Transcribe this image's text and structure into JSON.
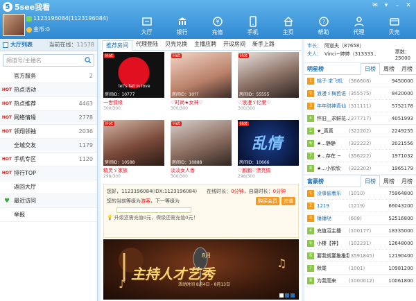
{
  "app": {
    "name": "5see我看",
    "logo_glyph": "5",
    "colors": {
      "brand": "#2f89d2",
      "hot": "#e2231a",
      "rank_top": "#f39a1c",
      "rank": "#8ac74b"
    }
  },
  "user": {
    "account": "1123196084(1123196084)",
    "coins": "金币:0"
  },
  "nav": [
    {
      "label": "大厅",
      "icon": "hall-icon"
    },
    {
      "label": "银行",
      "icon": "bank-icon"
    },
    {
      "label": "充值",
      "icon": "recharge-icon"
    },
    {
      "label": "手机",
      "icon": "phone-icon"
    },
    {
      "label": "主页",
      "icon": "home-icon"
    },
    {
      "label": "帮助",
      "icon": "help-icon"
    },
    {
      "label": "代理",
      "icon": "agent-icon"
    },
    {
      "label": "贝壳",
      "icon": "shell-icon"
    }
  ],
  "left": {
    "tab_label": "大厅列表",
    "online_label": "当前在线：",
    "online_count": "11578",
    "search_placeholder": "频道号/主播名",
    "categories": [
      {
        "badge": "",
        "name": "官方服务",
        "count": "2"
      },
      {
        "badge": "HOT",
        "name": "热点活动",
        "count": ""
      },
      {
        "badge": "HOT",
        "name": "热点推荐",
        "count": "4463"
      },
      {
        "badge": "HOT",
        "name": "网络情缘",
        "count": "2778"
      },
      {
        "badge": "HOT",
        "name": "领翔领袖",
        "count": "2036"
      },
      {
        "badge": "",
        "name": "全城交友",
        "count": "1179"
      },
      {
        "badge": "HOT",
        "name": "手机专区",
        "count": "1120"
      },
      {
        "badge": "HOT",
        "name": "排行TOP",
        "count": ""
      },
      {
        "badge": "",
        "name": "返回大厅",
        "count": ""
      },
      {
        "badge": "heart",
        "name": "最近访问",
        "count": ""
      },
      {
        "badge": "",
        "name": "举报",
        "count": ""
      }
    ]
  },
  "center": {
    "tabs": [
      "推荐房间",
      "代理登陆",
      "贝壳兑换",
      "主播应聘",
      "开设房间",
      "新手上路"
    ],
    "rooms": [
      {
        "hot": "Hot",
        "room_id": "房间ID：10777",
        "name": "一世情缘",
        "viewers": "300/300",
        "caption": "let's fall in love"
      },
      {
        "hot": "Hot",
        "room_id": "房间ID：10??",
        "name": "♡时尚★女神♡",
        "viewers": "300/300",
        "caption": ""
      },
      {
        "hot": "Hot",
        "room_id": "房间ID：55555",
        "name": "♡浪漫ゞ忆爱♡",
        "viewers": "300/300",
        "caption": ""
      },
      {
        "hot": "Hot",
        "room_id": "房间ID：10588",
        "name": "精灵ゞ家族",
        "viewers": "298/300",
        "caption": ""
      },
      {
        "hot": "Hot",
        "room_id": "房间ID：10888",
        "name": "淡淡女人香",
        "viewers": "300/300",
        "caption": ""
      },
      {
        "hot": "Hot",
        "room_id": "房间ID：10666",
        "name": "♡鹏鹏♡漂亮情",
        "viewers": "298/300",
        "caption": "乱情"
      }
    ],
    "info": {
      "greeting": "您好，1123196084(IDX:1123196084)",
      "online_time_label": "在线时长：",
      "online_time_value": "0分钟",
      "weekly_label": "，自周时长：",
      "weekly_value": "0分钟",
      "level_label": "您的当前等级为",
      "level_value": "游客",
      "next_level": "，下一等级为",
      "buy_vip": "购买会员",
      "recharge": "充值",
      "upgrade_hint": "升级还需充值0元，保级还需充值0元！"
    },
    "banner": {
      "eighth": "8月",
      "title": "主持人才艺秀",
      "subtitle": "活动时间 8月4日 - 8月13日"
    }
  },
  "right": {
    "chief_label": "市长：",
    "chief_value": "阿道夫（87658）",
    "wife_label": "夫人：",
    "wife_value": "Vinci~婷婷（313333..",
    "fans_label": "票数：",
    "fans_value": "25000",
    "stars_title": "明星榜",
    "rich_title": "富豪榜",
    "rank_tabs": [
      "日榜",
      "周榜",
      "月榜"
    ],
    "stars": [
      {
        "rank": "1",
        "name": "桃子 求飞机",
        "id": "(366608)",
        "value": "9450000"
      },
      {
        "rank": "2",
        "name": "浪漫ゞ梅芭语",
        "id": "(355575)",
        "value": "8420000"
      },
      {
        "rank": "3",
        "name": "年年财神真仙",
        "id": "(311111)",
        "value": "5752178"
      },
      {
        "rank": "4",
        "name": "怀旧__求鲜花...",
        "id": "(377717)",
        "value": "4051993"
      },
      {
        "rank": "5",
        "name": "★_真真",
        "id": "(322202)",
        "value": "2249255"
      },
      {
        "rank": "6",
        "name": "★...静静",
        "id": "(322222)",
        "value": "2021556"
      },
      {
        "rank": "7",
        "name": "★...存在 ~",
        "id": "(356222)",
        "value": "1971032"
      },
      {
        "rank": "8",
        "name": "★...小欣欣",
        "id": "(322202)",
        "value": "1965179"
      }
    ],
    "rich": [
      {
        "rank": "1",
        "name": "没事偷着乐",
        "id": "(1010)",
        "value": "75964800"
      },
      {
        "rank": "2",
        "name": "1219",
        "id": "(1219)",
        "value": "66043200"
      },
      {
        "rank": "3",
        "name": "锤锤哒",
        "id": "(608)",
        "value": "52516800"
      },
      {
        "rank": "4",
        "name": "充值沼主播",
        "id": "(100177)",
        "value": "18335000"
      },
      {
        "rank": "5",
        "name": "小楼【神】",
        "id": "(102231)",
        "value": "12648000"
      },
      {
        "rank": "6",
        "name": "要我就要推推我",
        "id": "(3591845)",
        "value": "12190400"
      },
      {
        "rank": "7",
        "name": "默尾",
        "id": "(1001)",
        "value": "10981200"
      },
      {
        "rank": "8",
        "name": "为我而来",
        "id": "(1000012)",
        "value": "10061800"
      }
    ]
  }
}
